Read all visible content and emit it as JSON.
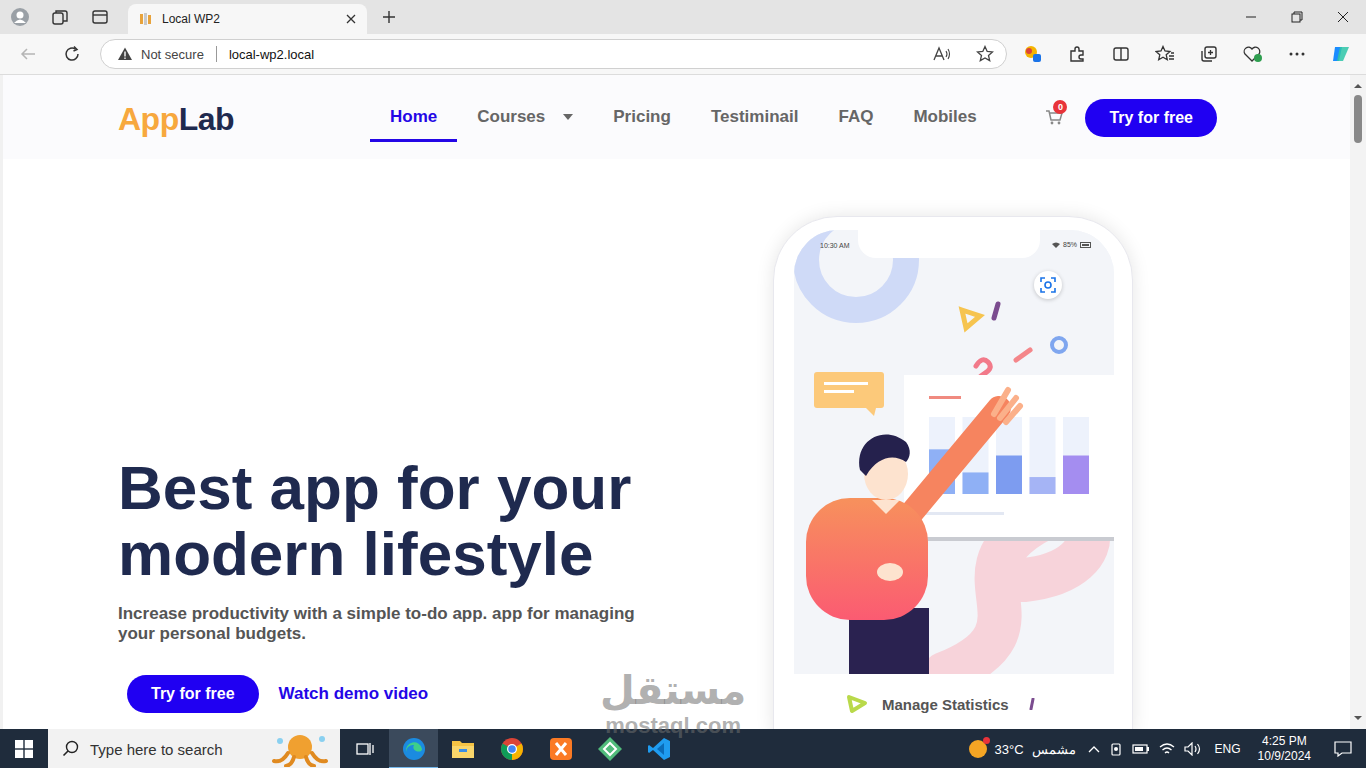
{
  "browser": {
    "tab": {
      "title": "Local WP2",
      "selected": true
    },
    "address": {
      "security": "Not secure",
      "url": "local-wp2.local"
    },
    "back_disabled": true
  },
  "page": {
    "logo": {
      "first": "App",
      "second": "Lab"
    },
    "nav": [
      {
        "label": "Home",
        "selected": true,
        "dropdown": false
      },
      {
        "label": "Courses",
        "selected": false,
        "dropdown": true
      },
      {
        "label": "Pricing",
        "selected": false,
        "dropdown": false
      },
      {
        "label": "Testiminail",
        "selected": false,
        "dropdown": false
      },
      {
        "label": "FAQ",
        "selected": false,
        "dropdown": false
      },
      {
        "label": "Mobiles",
        "selected": false,
        "dropdown": false
      }
    ],
    "cart": {
      "count": "0"
    },
    "header_button": "Try for free",
    "hero": {
      "title_lines": [
        "Best app for your",
        "modern lifestyle"
      ],
      "subtitle": "Increase productivity with a simple to-do app. app for managing your personal budgets.",
      "primary_button": "Try for free",
      "secondary_link": "Watch demo video"
    },
    "phone": {
      "time": "10:30 AM",
      "battery": "85%",
      "bars": [
        {
          "level": 0.58,
          "color": "#8fb0f5"
        },
        {
          "level": 0.28,
          "color": "#8fb0f5"
        },
        {
          "level": 0.5,
          "color": "#7d9cf0"
        },
        {
          "level": 0.22,
          "color": "#a5b4f5"
        },
        {
          "level": 0.5,
          "color": "#a48df0"
        }
      ],
      "caption": "Manage Statistics"
    }
  },
  "taskbar": {
    "search_placeholder": "Type here to search",
    "apps": [
      {
        "kind": "edge",
        "active": true
      },
      {
        "kind": "explorer",
        "active": false
      },
      {
        "kind": "chrome",
        "active": false
      },
      {
        "kind": "xampp",
        "active": false
      },
      {
        "kind": "local",
        "active": false
      },
      {
        "kind": "vscode",
        "active": false
      }
    ],
    "weather": {
      "temp": "33°C",
      "condition": "مشمس"
    },
    "language": "ENG",
    "time": "4:25 PM",
    "date": "10/9/2024"
  },
  "watermark": {
    "arabic": "مستقل",
    "latin": "mostaql.com"
  }
}
